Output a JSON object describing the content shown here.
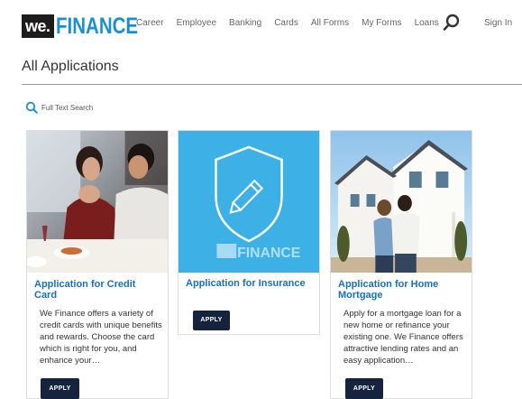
{
  "brand": {
    "logo_we": "we.",
    "logo_finance": "FINANCE",
    "accent": "#1a8fd6"
  },
  "nav": {
    "items": [
      "Career",
      "Employee",
      "Banking",
      "Cards",
      "All Forms",
      "My Forms",
      "Loans"
    ],
    "search_icon": "search-icon",
    "sign_in": "Sign In"
  },
  "page": {
    "title": "All Applications"
  },
  "search": {
    "label": "Full Text Search",
    "icon": "search-icon"
  },
  "cards": [
    {
      "title": "Application for Credit Card",
      "description": "We Finance offers a variety of credit cards with unique benefits and rewards. Choose the card which is right for you, and enhance your…",
      "button": "APPLY",
      "image": "couple-dining-photo"
    },
    {
      "title": "Application for Insurance",
      "description": "",
      "button": "APPLY",
      "image": "shield-pencil-illustration",
      "image_logo": "FINANCE"
    },
    {
      "title": "Application for Home Mortgage",
      "description": "Apply for a mortgage loan for a new home or refinance your existing one. We Finance offers attractive lending rates and an easy application…",
      "button": "APPLY",
      "image": "couple-house-photo"
    }
  ]
}
